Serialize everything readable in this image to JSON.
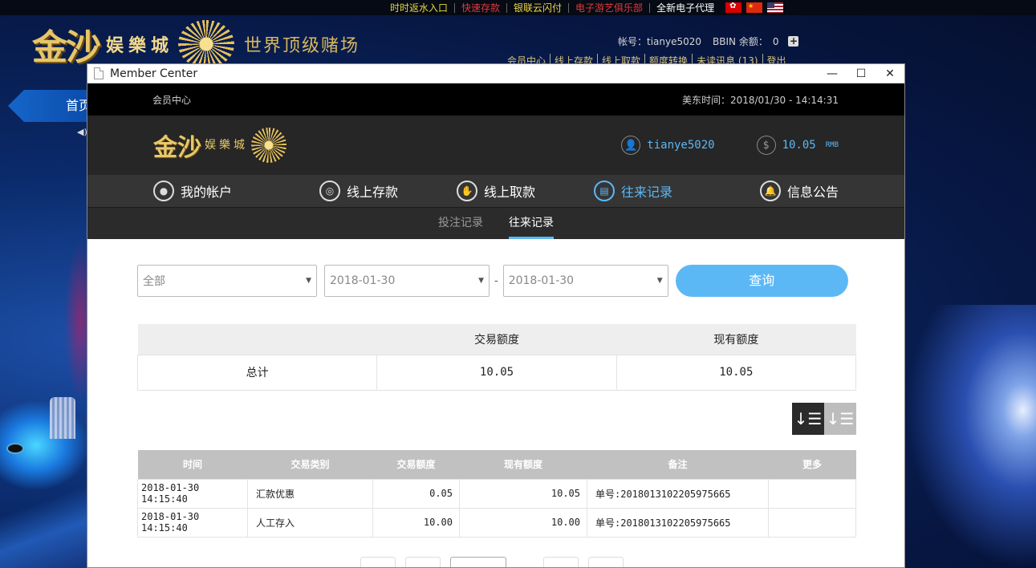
{
  "site": {
    "toplinks": [
      {
        "label": "时时返水入口",
        "color": "#e6d83a"
      },
      {
        "label": "快速存款",
        "color": "#e23a3a"
      },
      {
        "label": "银联云闪付",
        "color": "#f0d84a"
      },
      {
        "label": "电子游艺俱乐部",
        "color": "#e23a3a"
      },
      {
        "label": "全新电子代理",
        "color": "#ffffff"
      }
    ],
    "logo_main": "金沙",
    "logo_sub": "娱樂城",
    "slogan": "世界顶级赌场",
    "account_label": "帐号：tianye5020",
    "bbin_label": "BBIN 余额：",
    "bbin_value": "0",
    "links": [
      "会员中心",
      "线上存款",
      "线上取款",
      "额度转换",
      "未读讯息 (13)",
      "登出"
    ],
    "nav_home": "首页"
  },
  "window": {
    "title": "Member Center"
  },
  "member": {
    "top_left": "会员中心",
    "top_right": "美东时间：2018/01/30 - 14:14:31",
    "logo_main": "金沙",
    "logo_sub": "娱樂城",
    "username": "tianye5020",
    "balance": "10.05",
    "currency": "RMB",
    "nav": [
      {
        "label": "我的帐户",
        "icon": "user-icon",
        "active": false
      },
      {
        "label": "线上存款",
        "icon": "deposit-icon",
        "active": false
      },
      {
        "label": "线上取款",
        "icon": "withdraw-icon",
        "active": false
      },
      {
        "label": "往来记录",
        "icon": "records-icon",
        "active": true
      },
      {
        "label": "信息公告",
        "icon": "bell-icon",
        "active": false
      }
    ],
    "subtabs": [
      {
        "label": "投注记录",
        "active": false
      },
      {
        "label": "往来记录",
        "active": true
      }
    ],
    "filter": {
      "type": "全部",
      "date_from": "2018-01-30",
      "date_to": "2018-01-30",
      "separator": "-",
      "query_label": "查询"
    },
    "summary": {
      "headers": [
        "",
        "交易额度",
        "现有额度"
      ],
      "row": [
        "总计",
        "10.05",
        "10.05"
      ]
    },
    "records": {
      "headers": [
        "时间",
        "交易类别",
        "交易额度",
        "现有额度",
        "备注",
        "更多"
      ],
      "rows": [
        [
          "2018-01-30 14:15:40",
          "汇款优惠",
          "0.05",
          "10.05",
          "单号:20180131022059756​65",
          ""
        ],
        [
          "2018-01-30 14:15:40",
          "人工存入",
          "10.00",
          "10.00",
          "单号:201801310220597566​5",
          ""
        ]
      ]
    }
  }
}
